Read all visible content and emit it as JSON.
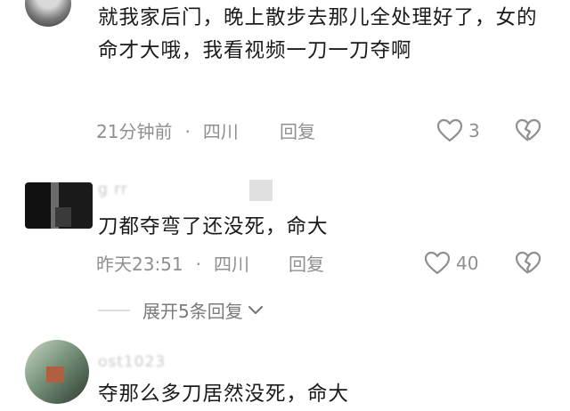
{
  "comments": [
    {
      "text": "就我家后门，晚上散步去那儿全处理好了，女的命才大哦，我看视频一刀一刀夺啊",
      "time": "21分钟前",
      "location": "四川",
      "reply_label": "回复",
      "likes": "3"
    },
    {
      "username": "g rr",
      "text": "刀都夺弯了还没死，命大",
      "time": "昨天23:51",
      "location": "四川",
      "reply_label": "回复",
      "likes": "40"
    },
    {
      "username": "ost1023",
      "text": "夺那么多刀居然没死，命大"
    }
  ],
  "expand_replies": "展开5条回复",
  "separator": "·"
}
